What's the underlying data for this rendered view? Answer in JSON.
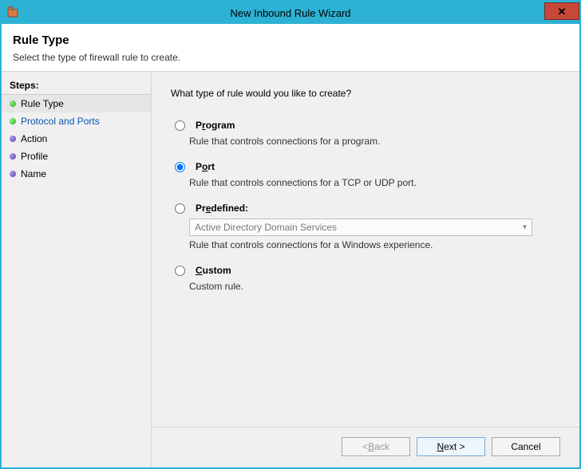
{
  "window": {
    "title": "New Inbound Rule Wizard",
    "close_glyph": "✕"
  },
  "header": {
    "title": "Rule Type",
    "subtitle": "Select the type of firewall rule to create."
  },
  "sidebar": {
    "steps_label": "Steps:",
    "items": [
      {
        "label": "Rule Type",
        "state": "current",
        "bullet": "green"
      },
      {
        "label": "Protocol and Ports",
        "state": "link",
        "bullet": "green"
      },
      {
        "label": "Action",
        "state": "future",
        "bullet": "purple"
      },
      {
        "label": "Profile",
        "state": "future",
        "bullet": "purple"
      },
      {
        "label": "Name",
        "state": "future",
        "bullet": "purple"
      }
    ]
  },
  "main": {
    "question": "What type of rule would you like to create?",
    "options": {
      "program": {
        "label_pre": "P",
        "label_u": "r",
        "label_post": "ogram",
        "desc": "Rule that controls connections for a program.",
        "selected": false
      },
      "port": {
        "label_pre": "P",
        "label_u": "o",
        "label_post": "rt",
        "desc": "Rule that controls connections for a TCP or UDP port.",
        "selected": true
      },
      "predefined": {
        "label_pre": "Pr",
        "label_u": "e",
        "label_post": "defined:",
        "desc": "Rule that controls connections for a Windows experience.",
        "selected": false,
        "dropdown_value": "Active Directory Domain Services",
        "dropdown_disabled": true
      },
      "custom": {
        "label_pre": "",
        "label_u": "C",
        "label_post": "ustom",
        "desc": "Custom rule.",
        "selected": false
      }
    }
  },
  "buttons": {
    "back_pre": "< ",
    "back_u": "B",
    "back_post": "ack",
    "next_pre": "",
    "next_u": "N",
    "next_post": "ext >",
    "cancel": "Cancel",
    "back_enabled": false,
    "next_enabled": true
  }
}
